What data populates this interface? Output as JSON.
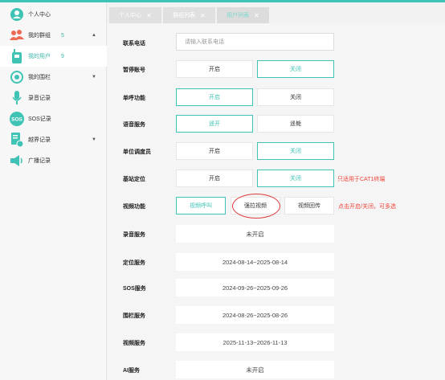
{
  "colors": {
    "accent": "#3fc3b5",
    "warning": "#f0443a"
  },
  "sidebar": {
    "items": [
      {
        "label": "个人中心",
        "icon": "user-circle-icon",
        "count": ""
      },
      {
        "label": "我的群组",
        "icon": "group-icon",
        "count": "5"
      },
      {
        "label": "我的用户",
        "icon": "walkie-talkie-icon",
        "count": "9"
      },
      {
        "label": "我的围栏",
        "icon": "fence-target-icon",
        "count": ""
      },
      {
        "label": "录音记录",
        "icon": "microphone-icon",
        "count": ""
      },
      {
        "label": "SOS记录",
        "icon": "sos-icon",
        "count": ""
      },
      {
        "label": "越界记录",
        "icon": "boundary-doc-icon",
        "count": ""
      },
      {
        "label": "广播记录",
        "icon": "broadcast-icon",
        "count": ""
      }
    ],
    "arrows": {
      "up": "▲",
      "down": "▼"
    }
  },
  "tabs": [
    {
      "label": "个人中心",
      "close": "✕"
    },
    {
      "label": "群组列表",
      "close": "✕"
    },
    {
      "label": "用户列表",
      "close": "✕"
    }
  ],
  "form": {
    "phone": {
      "label": "联系电话",
      "placeholder": "请输入联系电话"
    },
    "suspend": {
      "label": "暂停账号",
      "on": "开启",
      "off": "关闭",
      "selected": "off"
    },
    "single_call": {
      "label": "单呼功能",
      "on": "开启",
      "off": "关闭",
      "selected": "on"
    },
    "voice": {
      "label": "语音服务",
      "on": "遥开",
      "off": "遥毙",
      "selected": "on"
    },
    "dispatcher": {
      "label": "单位调度员",
      "on": "开启",
      "off": "关闭",
      "selected": "off"
    },
    "base_station": {
      "label": "基站定位",
      "on": "开启",
      "off": "关闭",
      "selected": "off",
      "note": "只适用于CAT1终端"
    },
    "video": {
      "label": "视频功能",
      "options": [
        "视频呼叫",
        "强拉视频",
        "视频回传"
      ],
      "note": "点击开启/关闭，可多选"
    },
    "services": [
      {
        "label": "录音服务",
        "value": "未开启"
      },
      {
        "label": "定位服务",
        "value": "2024-08-14~2025-08-14"
      },
      {
        "label": "SOS服务",
        "value": "2024-09-26~2025-09-26"
      },
      {
        "label": "围栏服务",
        "value": "2024-08-26~2025-08-26"
      },
      {
        "label": "视频服务",
        "value": "2025-11-13~2026-11-13"
      },
      {
        "label": "AI服务",
        "value": "未开启"
      }
    ]
  }
}
